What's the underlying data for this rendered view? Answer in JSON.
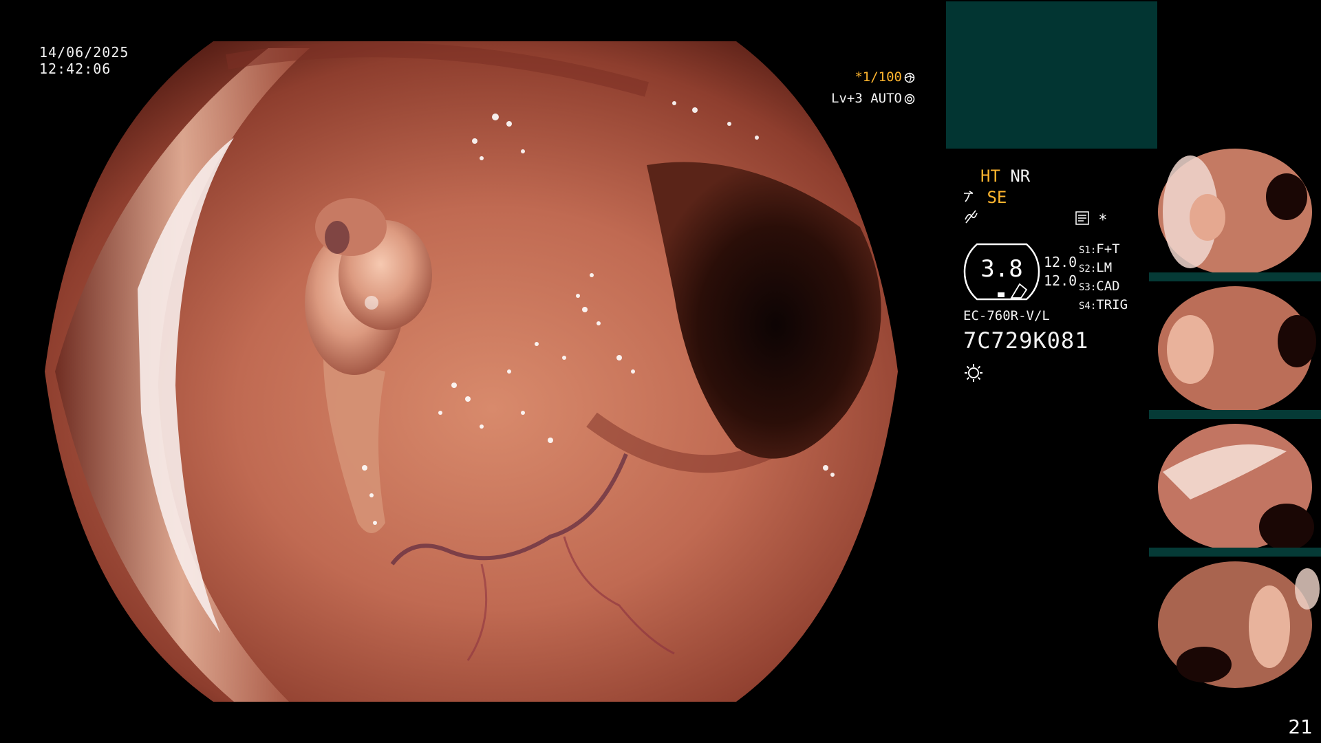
{
  "overlay": {
    "date": "14/06/2025",
    "time": "12:42:06",
    "shutter": "*1/100",
    "level": "Lv+3 AUTO",
    "shutter_icon": "aperture-icon",
    "auto_icon": "iris-icon"
  },
  "status": {
    "ht": "HT",
    "nr": "NR",
    "se": "SE",
    "mode_star": "*",
    "gauge_value": "3.8",
    "side_values": [
      "12.0",
      "12.0"
    ],
    "switches": [
      {
        "key": "S1:",
        "value": "F+T"
      },
      {
        "key": "S2:",
        "value": "LM"
      },
      {
        "key": "S3:",
        "value": "CAD"
      },
      {
        "key": "S4:",
        "value": "TRIG"
      }
    ],
    "model": "EC-760R-V/L",
    "serial": "7C729K081"
  },
  "thumbnails": [
    {
      "id": 1
    },
    {
      "id": 2
    },
    {
      "id": 3
    },
    {
      "id": 4
    }
  ],
  "page_number": "21",
  "colors": {
    "accent_orange": "#ffb52e",
    "info_box": "#023532",
    "mucosa": "#b85a45"
  }
}
